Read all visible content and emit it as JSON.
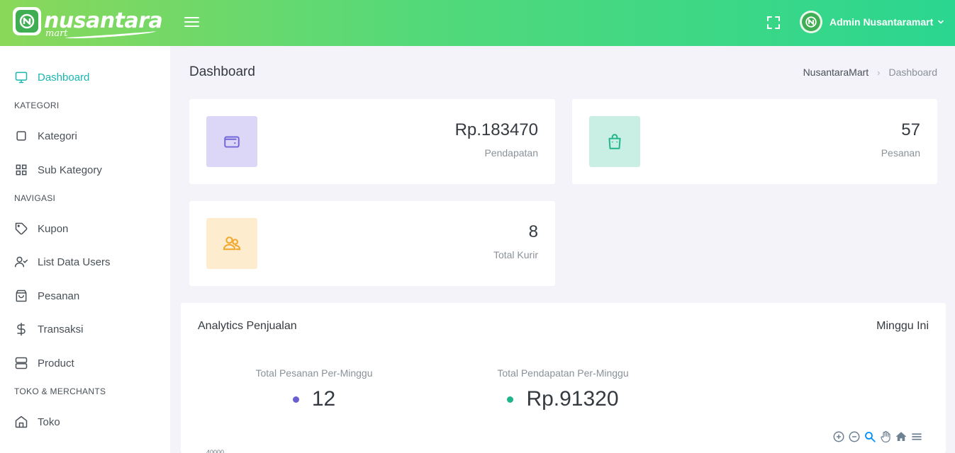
{
  "brand": {
    "name": "nusantara",
    "sub": "mart"
  },
  "header": {
    "user_name": "Admin Nusantaramart"
  },
  "sidebar": {
    "items": [
      {
        "label": "Dashboard",
        "icon": "monitor-icon",
        "active": true
      },
      {
        "section": "KATEGORI"
      },
      {
        "label": "Kategori",
        "icon": "square-icon"
      },
      {
        "label": "Sub Kategory",
        "icon": "grid-icon"
      },
      {
        "section": "NAVIGASI"
      },
      {
        "label": "Kupon",
        "icon": "tag-icon"
      },
      {
        "label": "List Data Users",
        "icon": "user-check-icon"
      },
      {
        "label": "Pesanan",
        "icon": "shopping-bag-icon"
      },
      {
        "label": "Transaksi",
        "icon": "dollar-icon"
      },
      {
        "label": "Product",
        "icon": "server-icon"
      },
      {
        "section": "TOKO & MERCHANTS"
      },
      {
        "label": "Toko",
        "icon": "home-icon"
      }
    ]
  },
  "page": {
    "title": "Dashboard",
    "breadcrumb": [
      "NusantaraMart",
      "Dashboard"
    ]
  },
  "stats": [
    {
      "value": "Rp.183470",
      "label": "Pendapatan",
      "icon": "wallet-icon",
      "bg": "#dcd6f7",
      "fg": "#7266d8"
    },
    {
      "value": "57",
      "label": "Pesanan",
      "icon": "shopping-bag-icon",
      "bg": "#c9efe4",
      "fg": "#1fb58a"
    },
    {
      "value": "8",
      "label": "Total Kurir",
      "icon": "users-icon",
      "bg": "#fdeccd",
      "fg": "#f0a831"
    }
  ],
  "analytics": {
    "title": "Analytics Penjualan",
    "period": "Minggu Ini",
    "metrics": [
      {
        "label": "Total Pesanan Per-Minggu",
        "value": "12",
        "color": "#6a5fd0"
      },
      {
        "label": "Total Pendapatan Per-Minggu",
        "value": "Rp.91320",
        "color": "#1fb58a"
      }
    ],
    "axis_top_label": "40000"
  },
  "colors": {
    "accent": "#19b7b0",
    "header_start": "#8ad85a",
    "header_end": "#2bd690"
  }
}
